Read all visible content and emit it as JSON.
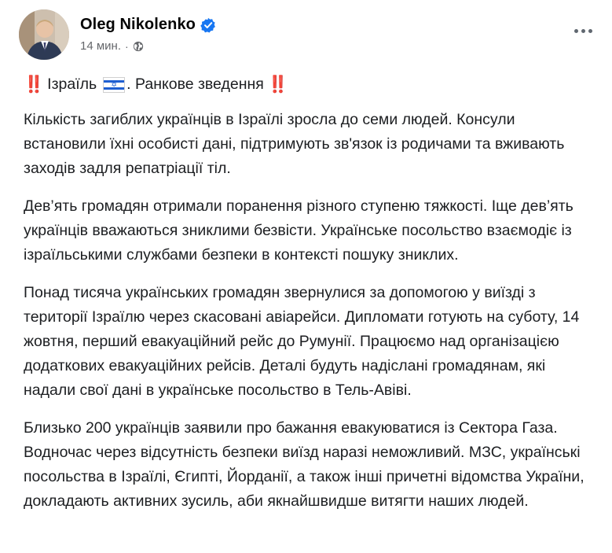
{
  "author": {
    "name": "Oleg Nikolenko",
    "time": "14 мин.",
    "separator": "·"
  },
  "icons": {
    "verified": "verified-badge-icon",
    "privacy": "globe-icon",
    "more": "more-options-icon",
    "alert": "double-exclamation-icon",
    "flag": "israel-flag-icon"
  },
  "colors": {
    "verified_blue": "#1877f2",
    "alert_red": "#e0245e",
    "meta_gray": "#65676b"
  },
  "post": {
    "title_left": "‼️",
    "title_text": "Ізраїль",
    "title_rest": ". Ранкове зведення",
    "title_right": "‼️",
    "paragraphs": [
      "Кількість загиблих українців в Ізраїлі зросла до семи людей. Консули встановили їхні особисті дані, підтримують зв'язок із родичами та вживають заходів задля репатріації тіл.",
      "Дев’ять громадян отримали поранення різного ступеню тяжкості. Іще дев’ять українців вважаються зниклими безвісти. Українське посольство взаємодіє із ізраїльськими службами безпеки в контексті пошуку зниклих.",
      "Понад тисяча українських громадян звернулися за допомогою у виїзді з території Ізраїлю через скасовані авіарейси. Дипломати готують на суботу, 14 жовтня, перший евакуаційний рейс до Румунії. Працюємо над організацією додаткових евакуаційних рейсів. Деталі будуть надіслані громадянам, які надали свої дані в українське посольство в Тель-Авіві.",
      "Близько 200 українців заявили про бажання евакуюватися із Сектора Газа. Водночас через відсутність безпеки виїзд наразі неможливий. МЗС, українські посольства в Ізраїлі, Єгипті, Йорданії, а також інші причетні відомства України, докладають активних зусиль, аби якнайшвидше витягти наших людей."
    ]
  }
}
